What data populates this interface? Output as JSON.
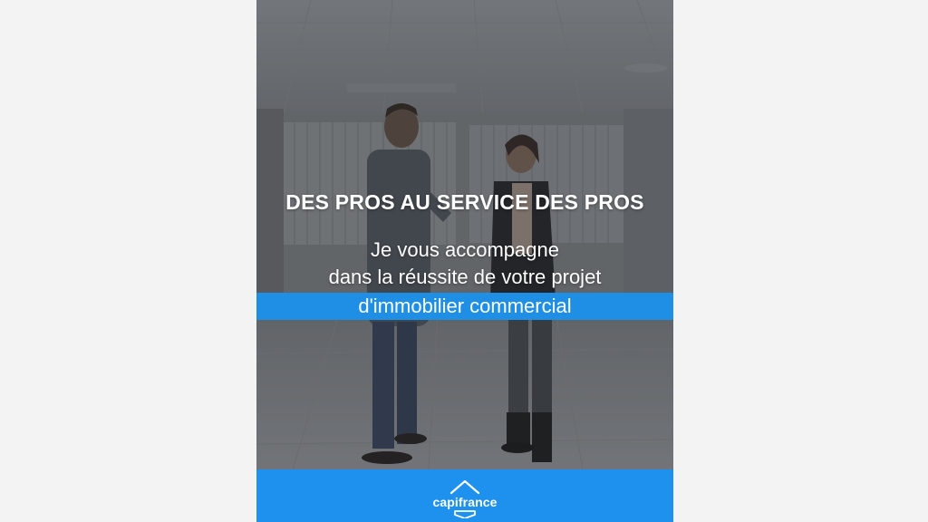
{
  "poster": {
    "headline": "DES PROS AU SERVICE DES PROS",
    "sub_line_1": "Je vous accompagne",
    "sub_line_2": "dans la réussite de votre projet",
    "highlight": "d'immobilier commercial"
  },
  "footer": {
    "brand": "capifrance",
    "color": "#1e90ee"
  },
  "colors": {
    "highlight_bg": "#1f8fe6",
    "page_bg": "#f3f3f3"
  }
}
